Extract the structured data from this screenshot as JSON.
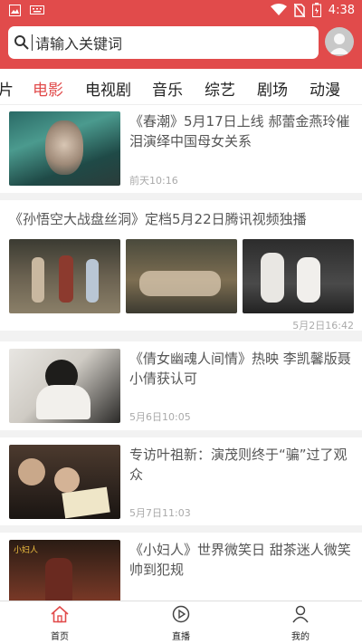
{
  "statusbar": {
    "time": "4:38",
    "icons": [
      "image-icon",
      "keyboard-icon",
      "wifi-icon",
      "no-sim-icon",
      "battery-icon"
    ]
  },
  "search": {
    "placeholder": "请输入关键词",
    "icon": "search-icon"
  },
  "tabs": [
    "片",
    "电影",
    "电视剧",
    "音乐",
    "综艺",
    "剧场",
    "动漫"
  ],
  "active_tab": "电影",
  "articles": [
    {
      "title": "《春潮》5月17日上线 郝蕾金燕玲催泪演绎中国母女关系",
      "time": "前天10:16"
    },
    {
      "title": "《孙悟空大战盘丝洞》定档5月22日腾讯视频独播",
      "time": "5月2日16:42"
    },
    {
      "title": "《倩女幽魂人间情》热映 李凯馨版聂小倩获认可",
      "time": "5月6日10:05"
    },
    {
      "title": "专访叶祖新：演茂则终于“骗”过了观众",
      "time": "5月7日11:03"
    },
    {
      "title": "《小妇人》世界微笑日 甜茶迷人微笑帅到犯规",
      "time": ""
    }
  ],
  "bottom_nav": [
    {
      "label": "首页",
      "icon": "home-icon"
    },
    {
      "label": "直播",
      "icon": "play-icon"
    },
    {
      "label": "我的",
      "icon": "user-icon"
    }
  ],
  "colors": {
    "accent": "#e14b4b",
    "background": "#f2f2f2"
  }
}
